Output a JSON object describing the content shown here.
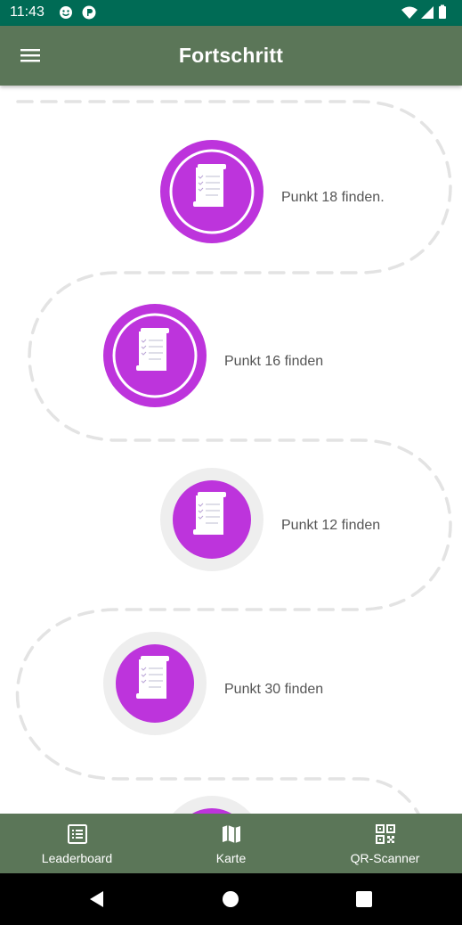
{
  "status_bar": {
    "time": "11:43",
    "icons": [
      "smiley-notification-icon",
      "app-notification-icon",
      "wifi-icon",
      "signal-icon",
      "battery-icon"
    ]
  },
  "app_bar": {
    "title": "Fortschritt",
    "menu_icon": "hamburger-menu-icon"
  },
  "progress": {
    "milestones": [
      {
        "label": "Punkt 18 finden.",
        "icon": "checklist-scroll-icon",
        "completed": true
      },
      {
        "label": "Punkt 16 finden",
        "icon": "checklist-scroll-icon",
        "completed": true
      },
      {
        "label": "Punkt 12 finden",
        "icon": "checklist-scroll-icon",
        "completed": false
      },
      {
        "label": "Punkt 30 finden",
        "icon": "checklist-scroll-icon",
        "completed": false
      }
    ]
  },
  "bottom_nav": {
    "items": [
      {
        "label": "Leaderboard",
        "icon": "list-icon"
      },
      {
        "label": "Karte",
        "icon": "map-icon"
      },
      {
        "label": "QR-Scanner",
        "icon": "qr-code-icon"
      }
    ]
  },
  "colors": {
    "status_bar": "#006b55",
    "app_bar": "#5b7658",
    "accent_purple": "#bd34dc",
    "pending_ring": "#eeeeee",
    "path_dash": "#e3e3e3",
    "label_text": "#555555"
  }
}
